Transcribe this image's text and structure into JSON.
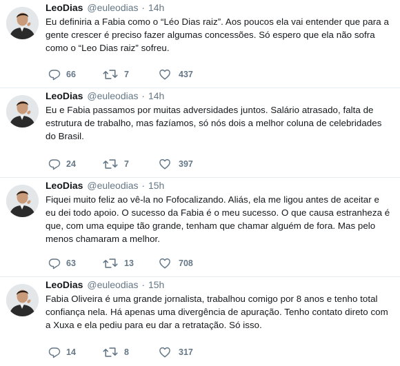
{
  "tweets": [
    {
      "name": "LeoDias",
      "handle": "@euleodias",
      "separator": "·",
      "time": "14h",
      "text": "Eu definiria a Fabia como o “Léo Dias raiz”. Aos poucos ela vai entender que para a gente crescer é preciso fazer algumas concessões. Só espero que ela não sofra como o “Leo Dias raiz” sofreu.",
      "replies": "66",
      "retweets": "7",
      "likes": "437"
    },
    {
      "name": "LeoDias",
      "handle": "@euleodias",
      "separator": "·",
      "time": "14h",
      "text": "Eu e Fabia passamos por muitas adversidades juntos. Salário atrasado, falta de estrutura de trabalho, mas fazíamos, só nós dois a melhor coluna de celebridades do Brasil.",
      "replies": "24",
      "retweets": "7",
      "likes": "397"
    },
    {
      "name": "LeoDias",
      "handle": "@euleodias",
      "separator": "·",
      "time": "15h",
      "text": "Fiquei muito feliz ao vê-la no Fofocalizando. Aliás, ela me ligou antes de aceitar e eu dei todo apoio. O sucesso da Fabia é o meu sucesso. O que causa estranheza é que, com uma equipe tão grande, tenham que chamar alguém de fora. Mas pelo menos chamaram a melhor.",
      "replies": "63",
      "retweets": "13",
      "likes": "708"
    },
    {
      "name": "LeoDias",
      "handle": "@euleodias",
      "separator": "·",
      "time": "15h",
      "text": "Fabia Oliveira é uma grande jornalista, trabalhou comigo por 8 anos e tenho total confiança nela. Há apenas uma divergência de apuração. Tenho contato direto com a Xuxa e ela pediu para eu dar a retratação. Só isso.",
      "replies": "14",
      "retweets": "8",
      "likes": "317"
    }
  ],
  "icons": {
    "reply": "reply-icon",
    "retweet": "retweet-icon",
    "like": "heart-icon"
  },
  "colors": {
    "text": "#14171a",
    "secondary": "#657786",
    "divider": "#e6ecf0"
  }
}
